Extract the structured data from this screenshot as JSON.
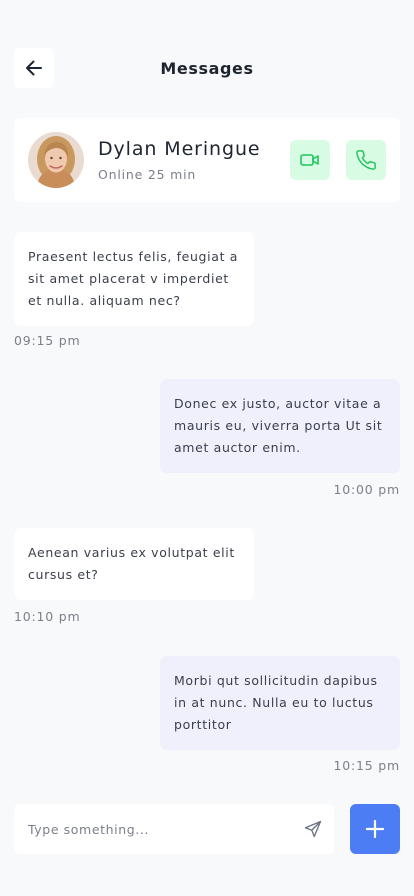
{
  "header": {
    "title": "Messages",
    "back_icon": "arrow-left-icon"
  },
  "contact": {
    "name": "Dylan Meringue",
    "status": "Online 25 min",
    "avatar": "avatar-photo",
    "actions": [
      {
        "icon": "video-camera-icon",
        "color": "#22c55e",
        "background": "#d7fbe3"
      },
      {
        "icon": "phone-icon",
        "color": "#22c55e",
        "background": "#d7fbe3"
      }
    ]
  },
  "messages": [
    {
      "direction": "incoming",
      "text": "Praesent lectus felis, feugiat a sit amet placerat v imperdiet et nulla. aliquam nec?",
      "time": "09:15 pm"
    },
    {
      "direction": "outgoing",
      "text": "Donec ex justo, auctor vitae a mauris eu, viverra porta  Ut sit amet auctor enim.",
      "time": "10:00 pm"
    },
    {
      "direction": "incoming",
      "text": "Aenean varius ex volutpat elit cursus et?",
      "time": "10:10 pm"
    },
    {
      "direction": "outgoing",
      "text": "Morbi qut sollicitudin dapibus in at nunc. Nulla eu to luctus porttitor",
      "time": "10:15 pm"
    }
  ],
  "composer": {
    "placeholder": "Type something...",
    "value": "",
    "send_icon": "send-icon",
    "add_icon": "plus-icon"
  },
  "colors": {
    "background": "#f8f9fa",
    "card": "#ffffff",
    "outgoing_bubble": "#eff0fb",
    "accent": "#4d7df5",
    "call_green": "#22c55e",
    "call_green_bg": "#d7fbe3",
    "muted_text": "#7c808a"
  }
}
